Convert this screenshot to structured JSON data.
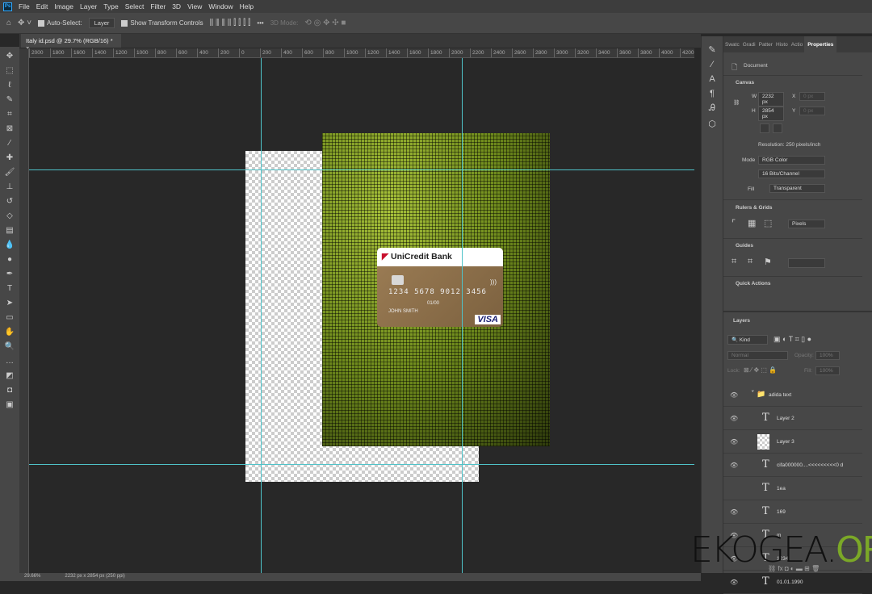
{
  "menu": [
    "File",
    "Edit",
    "Image",
    "Layer",
    "Type",
    "Select",
    "Filter",
    "3D",
    "View",
    "Window",
    "Help"
  ],
  "app_logo": "Ps",
  "options": {
    "auto_select": "Auto-Select:",
    "auto_select_value": "Layer",
    "show_transform": "Show Transform Controls",
    "mode_3d": "3D Mode:",
    "more": "•••"
  },
  "doc_tab": "Italy id.psd @ 29.7% (RGB/16) *",
  "ruler_labels": [
    "2000",
    "1800",
    "1600",
    "1400",
    "1200",
    "1000",
    "800",
    "600",
    "400",
    "200",
    "0",
    "200",
    "400",
    "600",
    "800",
    "1000",
    "1200",
    "1400",
    "1600",
    "1800",
    "2000",
    "2200",
    "2400",
    "2600",
    "2800",
    "3000",
    "3200",
    "3400",
    "3600",
    "3800",
    "4000",
    "4200"
  ],
  "card": {
    "bank_mark": "◤",
    "bank": "UniCredit Bank",
    "number": "1234 5678 9012 3456",
    "expiry": "01/00",
    "holder": "JOHN SMITH",
    "brand": "VISA",
    "contactless": ")))"
  },
  "panel_tabs": [
    "Swatc",
    "Gradi",
    "Patter",
    "Histo",
    "Actio",
    "Properties"
  ],
  "properties": {
    "document": "Document",
    "canvas": "Canvas",
    "w_label": "W",
    "w": "2232 px",
    "h_label": "H",
    "h": "2854 px",
    "x_label": "X",
    "y_label": "Y",
    "x": "0 px",
    "y": "0 px",
    "resolution": "Resolution: 250 pixels/inch",
    "mode_label": "Mode",
    "mode": "RGB Color",
    "depth": "16 Bits/Channel",
    "fill_label": "Fill",
    "fill": "Transparent",
    "rulers_grids": "Rulers & Grids",
    "units": "Pixels",
    "guides": "Guides",
    "quick_actions": "Quick Actions"
  },
  "layers": {
    "title": "Layers",
    "kind": "Kind",
    "blend": "Normal",
    "opacity_label": "Opacity:",
    "opacity": "100%",
    "lock_label": "Lock:",
    "fill_label": "Fill:",
    "fill": "100%",
    "items": [
      {
        "name": "adida text",
        "type": "group"
      },
      {
        "name": "Layer 2",
        "type": "text"
      },
      {
        "name": "Layer 3",
        "type": "image"
      },
      {
        "name": "cifa000000....<<<<<<<<<0 d",
        "type": "text"
      },
      {
        "name": "1ea",
        "type": "text"
      },
      {
        "name": "169",
        "type": "text"
      },
      {
        "name": "m",
        "type": "text"
      },
      {
        "name": "1234",
        "type": "text"
      },
      {
        "name": "01.01.1990",
        "type": "text"
      }
    ]
  },
  "status": {
    "zoom": "29.66%",
    "info": "2232 px x 2854 px (250 ppi)"
  },
  "watermark": {
    "a": "EKOGEA.",
    "b": "ORG"
  },
  "colors": {
    "guide": "#4fc3c9",
    "accent": "#31a8ff"
  }
}
